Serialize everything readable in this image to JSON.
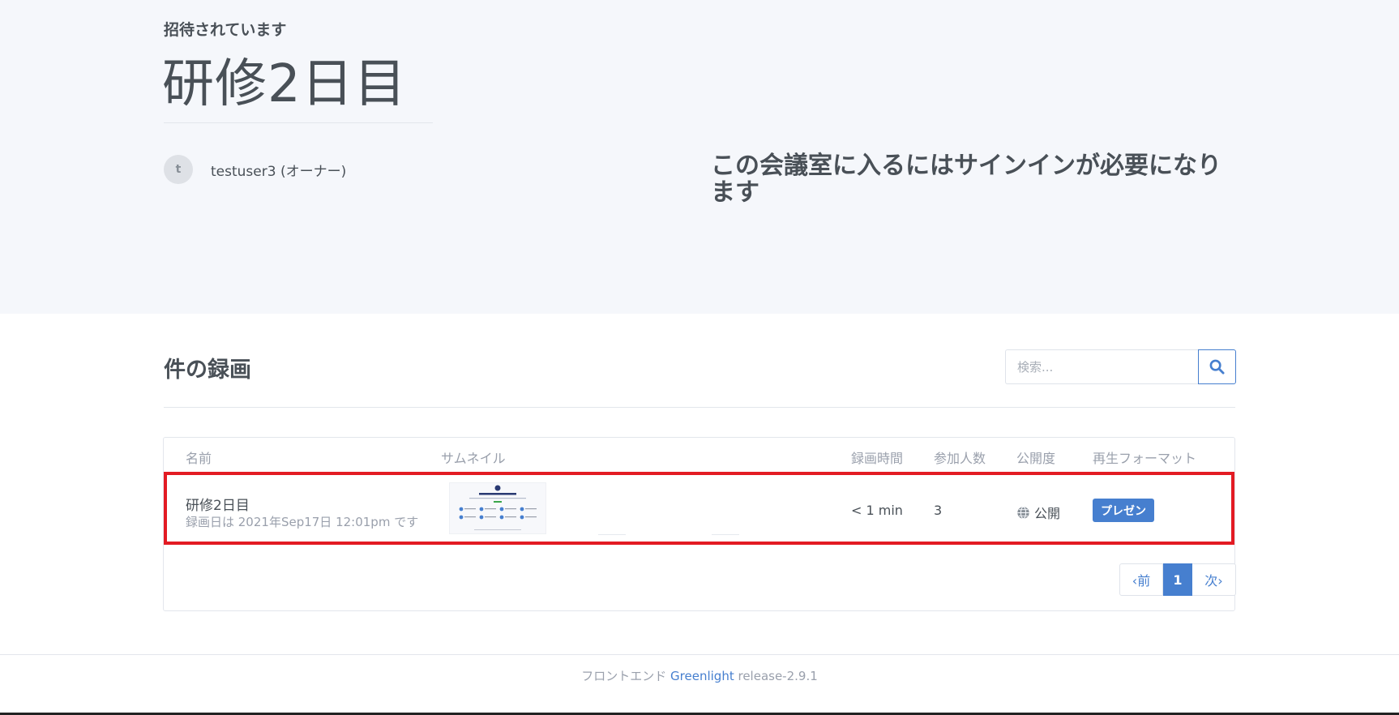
{
  "header": {
    "invited_label": "招待されています",
    "room_title": "研修2日目",
    "owner": {
      "avatar_initial": "t",
      "name": "testuser3 (オーナー)"
    },
    "signin_message": "この会議室に入るにはサインインが必要になります"
  },
  "recordings": {
    "title": "件の録画",
    "search_placeholder": "検索...",
    "columns": [
      "名前",
      "サムネイル",
      "録画時間",
      "参加人数",
      "公開度",
      "再生フォーマット"
    ],
    "rows": [
      {
        "name": "研修2日目",
        "date": "録画日は 2021年Sep17日 12:01pm です",
        "length": "< 1 min",
        "participants": "3",
        "visibility": "公開",
        "format": "プレゼン"
      }
    ],
    "pagination": {
      "prev": "‹前",
      "current": "1",
      "next": "次›"
    }
  },
  "footer": {
    "prefix": "フロントエンド",
    "brand": "Greenlight",
    "version": "release-2.9.1"
  },
  "colors": {
    "accent": "#467fcf",
    "highlight_border": "#e31b23",
    "hero_bg": "#f5f7fb"
  }
}
